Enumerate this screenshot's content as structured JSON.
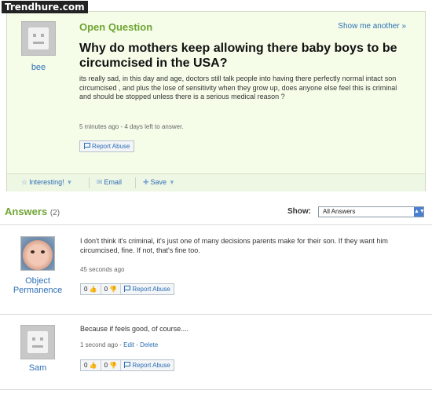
{
  "watermark": "Trendhure.com",
  "question": {
    "status_label": "Open Question",
    "show_another": "Show me another »",
    "asker": "bee",
    "title": "Why do mothers keep allowing there baby boys to be circumcised in the USA?",
    "body": "its really sad, in this day and age, doctors still talk people into having there perfectly normal intact son circumcised , and plus the lose of sensitivity when they grow up, does anyone else feel this is criminal and should be stopped unless there is a serious medical reason ?",
    "meta": "5 minutes ago - 4 days left to answer.",
    "report_abuse": "Report Abuse"
  },
  "actions": {
    "interesting": "Interesting!",
    "email": "Email",
    "save": "Save"
  },
  "answers": {
    "title": "Answers",
    "count": "(2)",
    "show_label": "Show:",
    "filter_selected": "All Answers",
    "items": [
      {
        "user": "Object Permanence",
        "text": "I don't think it's criminal, it's just one of many decisions parents make for their son. If they want him circumcised, fine. If not, that's fine too.",
        "time": "45 seconds ago",
        "thumbs_up": "0",
        "thumbs_down": "0",
        "report_abuse": "Report Abuse"
      },
      {
        "user": "Sam",
        "text": "Because if feels good, of course....",
        "time": "1 second ago",
        "edit": "Edit",
        "delete": "Delete",
        "thumbs_up": "0",
        "thumbs_down": "0",
        "report_abuse": "Report Abuse"
      }
    ]
  },
  "colors": {
    "accent_green": "#6fa533",
    "link_blue": "#2d6fb5",
    "question_bg": "#f5fde9"
  },
  "icons": [
    "star-icon",
    "email-icon",
    "plus-icon",
    "flag-icon",
    "thumbs-up-icon",
    "thumbs-down-icon",
    "chevron-down-icon"
  ]
}
